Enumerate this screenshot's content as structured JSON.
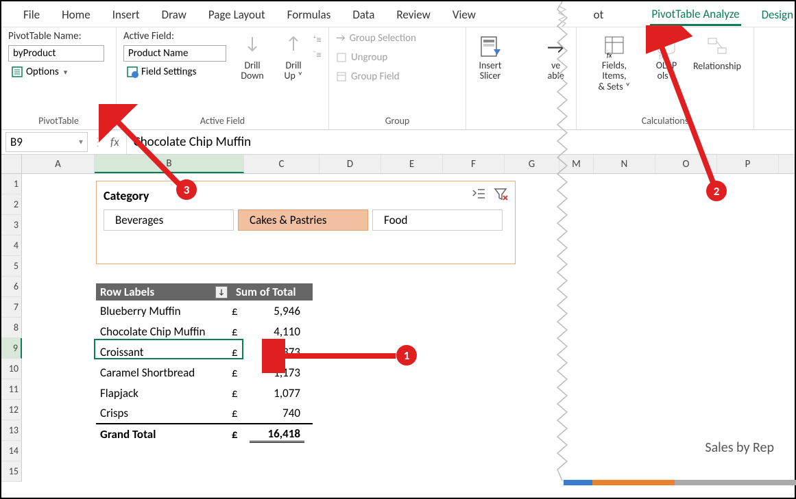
{
  "tabs": {
    "file": "File",
    "home": "Home",
    "insert": "Insert",
    "draw": "Draw",
    "pageLayout": "Page Layout",
    "formulas": "Formulas",
    "data": "Data",
    "review": "Review",
    "view": "View",
    "ot": "ot",
    "ptAnalyze": "PivotTable Analyze",
    "design": "Design"
  },
  "ribbon": {
    "ptNameLabel": "PivotTable Name:",
    "ptName": "byProduct",
    "options": "Options",
    "ptGroup": "PivotTable",
    "activeFieldLabel": "Active Field:",
    "activeField": "Product Name",
    "fieldSettings": "Field Settings",
    "activeFieldGroup": "Active Field",
    "drillDown": "Drill Down",
    "drillUp": "Drill Up",
    "groupSelection": "Group Selection",
    "ungroup": "Ungroup",
    "groupField": "Group Field",
    "groupGroup": "Group",
    "insertSlicer": "Insert Slicer",
    "ve": "ve",
    "able": "able",
    "fields": "Fields, Items, & Sets",
    "olap": "OLAP",
    "ols": "ols",
    "relationships": "Relationship",
    "calcGroup": "Calculations"
  },
  "nameBox": "B9",
  "formula": "Chocolate Chip Muffin",
  "cols": [
    "A",
    "B",
    "C",
    "D",
    "E",
    "F",
    "G",
    "M",
    "N",
    "O",
    "P"
  ],
  "rows": [
    "1",
    "2",
    "3",
    "4",
    "5",
    "6",
    "7",
    "8",
    "9",
    "10",
    "11",
    "12",
    "13",
    "14",
    "15"
  ],
  "slicer": {
    "title": "Category",
    "items": [
      "Beverages",
      "Cakes & Pastries",
      "Food"
    ],
    "selected": 1
  },
  "pivot": {
    "h1": "Row Labels",
    "h2": "Sum of Total",
    "currency": "£",
    "rows": [
      {
        "label": "Blueberry Muffin",
        "val": "5,946"
      },
      {
        "label": "Chocolate Chip Muffin",
        "val": "4,110"
      },
      {
        "label": "Croissant",
        "val": "3,373"
      },
      {
        "label": "Caramel Shortbread",
        "val": "1,173"
      },
      {
        "label": "Flapjack",
        "val": "1,077"
      },
      {
        "label": "Crisps",
        "val": "740"
      }
    ],
    "grand": {
      "label": "Grand Total",
      "val": "16,418"
    }
  },
  "chartTitle": "Sales by Rep",
  "callouts": {
    "c1": "1",
    "c2": "2",
    "c3": "3"
  }
}
